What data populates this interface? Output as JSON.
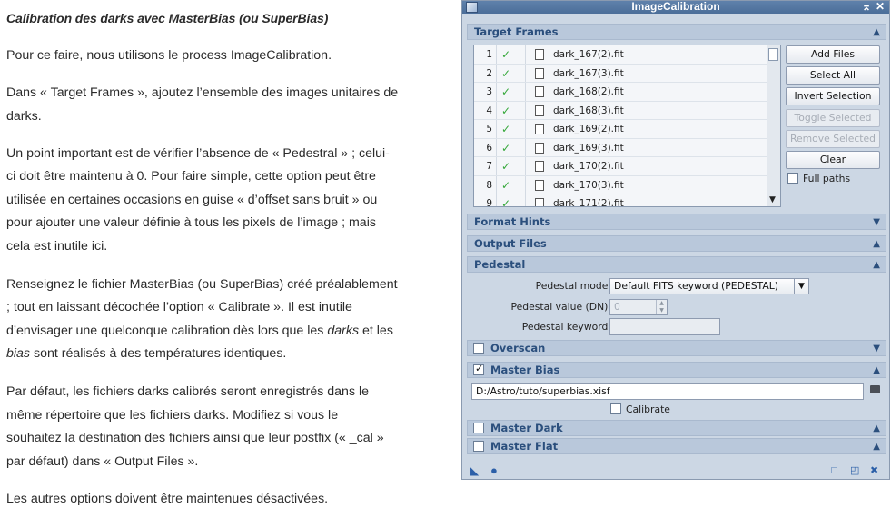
{
  "article": {
    "heading": "Calibration des darks avec MasterBias (ou SuperBias)",
    "lines": [
      "Pour ce faire, nous utilisons le process ImageCalibration.",
      "Dans « Target Frames », ajoutez l’ensemble des images unitaires de",
      "darks.",
      "Un point important est de vérifier l’absence de « Pedestral » ; celui-",
      "ci doit être maintenu à 0. Pour faire simple, cette option peut être",
      "utilisée en certaines occasions en guise « d’offset sans bruit » ou",
      "pour ajouter une valeur définie à tous les pixels de l’image ; mais",
      "cela est inutile ici.",
      "Renseignez le fichier MasterBias (ou SuperBias) créé préalablement",
      "; tout en laissant décochée l’option « Calibrate ». Il est inutile",
      "d’envisager une quelconque calibration dès lors que les",
      "darks",
      " et les",
      "bias",
      " sont réalisés à des températures identiques.",
      "Par défaut, les fichiers darks calibrés seront enregistrés dans le",
      "même répertoire que les fichiers darks. Modifiez si vous le",
      "souhaitez la destination des fichiers ainsi que leur postfix (« _cal »",
      "par défaut) dans « Output Files ».",
      "Les autres options doivent être maintenues désactivées."
    ]
  },
  "window": {
    "title": "ImageCalibration",
    "title_buttons": [
      "⌅",
      "✕"
    ],
    "sections": {
      "target_frames": "Target Frames",
      "format_hints": "Format Hints",
      "output_files": "Output Files",
      "pedestal": "Pedestal",
      "overscan": "Overscan",
      "master_bias": "Master Bias",
      "master_dark": "Master Dark",
      "master_flat": "Master Flat"
    },
    "frames": [
      {
        "index": "1",
        "name": "dark_167(2).fit"
      },
      {
        "index": "2",
        "name": "dark_167(3).fit"
      },
      {
        "index": "3",
        "name": "dark_168(2).fit"
      },
      {
        "index": "4",
        "name": "dark_168(3).fit"
      },
      {
        "index": "5",
        "name": "dark_169(2).fit"
      },
      {
        "index": "6",
        "name": "dark_169(3).fit"
      },
      {
        "index": "7",
        "name": "dark_170(2).fit"
      },
      {
        "index": "8",
        "name": "dark_170(3).fit"
      },
      {
        "index": "9",
        "name": "dark_171(2).fit"
      }
    ],
    "buttons": {
      "add_files": "Add Files",
      "select_all": "Select All",
      "invert_selection": "Invert Selection",
      "toggle_selected": "Toggle Selected",
      "remove_selected": "Remove Selected",
      "clear": "Clear"
    },
    "full_paths_label": "Full paths",
    "pedestal": {
      "mode_label": "Pedestal mode:",
      "mode_value": "Default FITS keyword (PEDESTAL)",
      "value_label": "Pedestal value (DN):",
      "value": "0",
      "keyword_label": "Pedestal keyword:",
      "keyword_value": ""
    },
    "master_bias": {
      "path": "D:/Astro/tuto/superbias.xisf",
      "calibrate_label": "Calibrate"
    }
  },
  "colors": {
    "window_bg": "#ccd7e4",
    "title_bg": "#4b6e99",
    "section_text": "#2b4f7d",
    "check_green": "#35a83a"
  }
}
